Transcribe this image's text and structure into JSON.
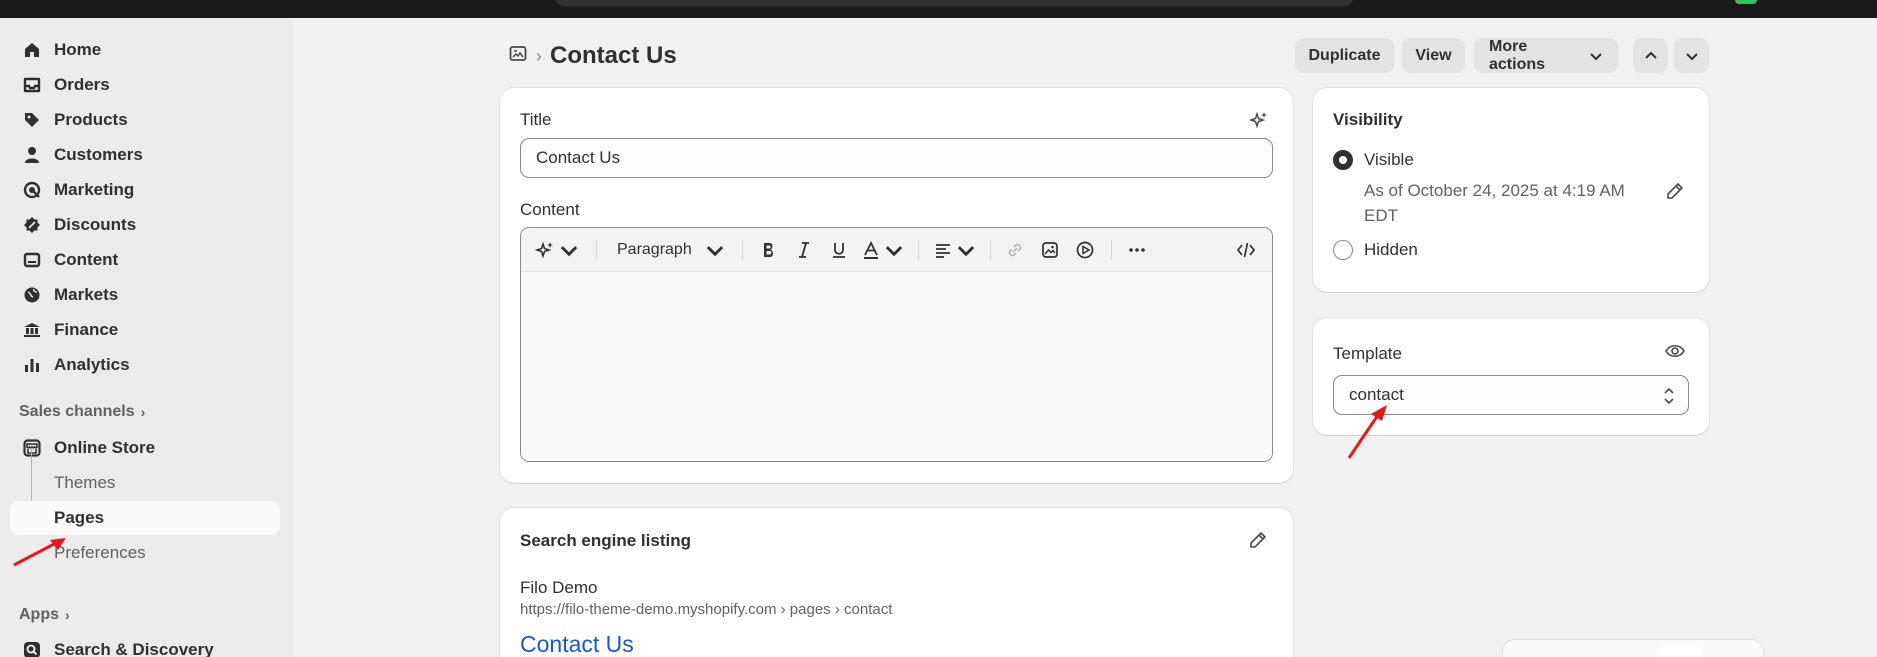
{
  "sidebar": {
    "items": [
      {
        "label": "Home",
        "icon": "home-icon"
      },
      {
        "label": "Orders",
        "icon": "inbox-icon"
      },
      {
        "label": "Products",
        "icon": "tag-icon"
      },
      {
        "label": "Customers",
        "icon": "person-icon"
      },
      {
        "label": "Marketing",
        "icon": "target-icon"
      },
      {
        "label": "Discounts",
        "icon": "discount-icon"
      },
      {
        "label": "Content",
        "icon": "image-icon"
      },
      {
        "label": "Markets",
        "icon": "globe-icon"
      },
      {
        "label": "Finance",
        "icon": "bank-icon"
      },
      {
        "label": "Analytics",
        "icon": "bar-chart-icon"
      }
    ],
    "sales_channels_label": "Sales channels",
    "online_store_label": "Online Store",
    "sub_items": [
      "Themes",
      "Pages",
      "Preferences"
    ],
    "apps_label": "Apps",
    "search_discovery_label": "Search & Discovery"
  },
  "header": {
    "title": "Contact Us",
    "duplicate_label": "Duplicate",
    "view_label": "View",
    "more_actions_label": "More actions"
  },
  "main": {
    "title_label": "Title",
    "title_value": "Contact Us",
    "content_label": "Content",
    "paragraph_label": "Paragraph",
    "seo": {
      "heading": "Search engine listing",
      "store_name": "Filo Demo",
      "url": "https://filo-theme-demo.myshopify.com › pages › contact",
      "page_title": "Contact Us"
    }
  },
  "visibility": {
    "heading": "Visibility",
    "visible_label": "Visible",
    "visible_note_line1": "As of October 24, 2025 at 4:19 AM",
    "visible_note_line2": "EDT",
    "hidden_label": "Hidden"
  },
  "template": {
    "heading": "Template",
    "value": "contact"
  },
  "colors": {
    "annotation_arrow": "#e5191c",
    "link_blue": "#1a56db"
  }
}
